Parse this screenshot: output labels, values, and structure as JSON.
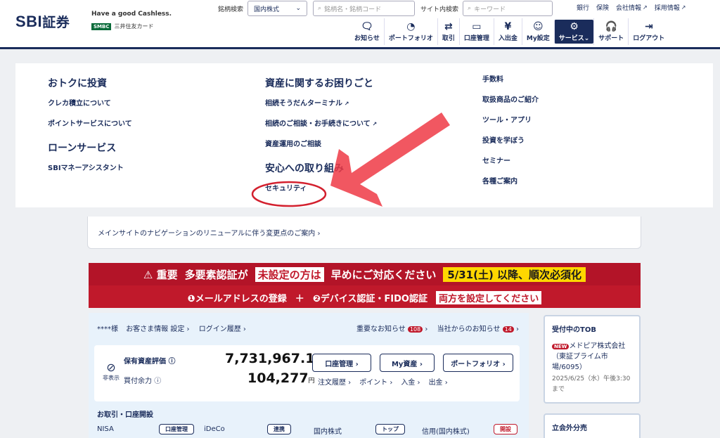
{
  "brand": {
    "logo_main": "SBI",
    "logo_sub": "証券",
    "tagline": "Have a good Cashless.",
    "smbc_badge": "SMBC",
    "smbc_text": "三井住友カード"
  },
  "search": {
    "stock_label": "銘柄検索",
    "market_select": "国内株式",
    "stock_placeholder": "銘柄名・銘柄コード",
    "site_label": "サイト内検索",
    "site_placeholder": "キーワード"
  },
  "top_links": [
    "銀行",
    "保険",
    "会社情報",
    "採用情報"
  ],
  "nav": [
    {
      "label": "お知らせ",
      "icon": "message-icon",
      "glyph": "🗨"
    },
    {
      "label": "ポートフォリオ",
      "icon": "pie-chart-icon",
      "glyph": "◔"
    },
    {
      "label": "取引",
      "icon": "exchange-icon",
      "glyph": "⇄"
    },
    {
      "label": "口座管理",
      "icon": "account-icon",
      "glyph": "▭"
    },
    {
      "label": "入出金",
      "icon": "yen-icon",
      "glyph": "¥"
    },
    {
      "label": "My設定",
      "icon": "user-icon",
      "glyph": "☺"
    },
    {
      "label": "サービス",
      "icon": "service-icon",
      "glyph": "⚙"
    },
    {
      "label": "サポート",
      "icon": "headset-icon",
      "glyph": "🎧"
    },
    {
      "label": "ログアウト",
      "icon": "logout-icon",
      "glyph": "⇥"
    }
  ],
  "mega_menu": {
    "col1": {
      "heading1": "おトクに投資",
      "links1": [
        "クレカ積立について",
        "ポイントサービスについて"
      ],
      "heading2": "ローンサービス",
      "links2": [
        "SBIマネーアシスタント"
      ]
    },
    "col2": {
      "heading1": "資産に関するお困りごと",
      "links1": [
        "相続そうだんターミナル",
        "相続のご相談・お手続きについて",
        "資産運用のご相談"
      ],
      "heading2": "安心への取り組み",
      "links2": [
        "セキュリティ"
      ]
    },
    "col3": {
      "links": [
        "手数料",
        "取扱商品のご紹介",
        "ツール・アプリ",
        "投資を学ぼう",
        "セミナー",
        "各種ご案内"
      ]
    }
  },
  "notice": {
    "text": "メインサイトのナビゲーションのリニューアルに伴う変更点のご案内 ›"
  },
  "banner": {
    "important": "⚠ 重要",
    "line1_a": "多要素認証が",
    "line1_b": "未設定の方は",
    "line1_c": "早めにご対応ください",
    "line1_d": "5/31(土) 以降、順次必須化",
    "line2_a": "❶メールアドレスの登録",
    "plus": "＋",
    "line2_b": "❷デバイス認証・FIDO認証",
    "line2_c": "両方を設定してください"
  },
  "account": {
    "user": "****様",
    "customer_info": "お客さま情報 設定 ›",
    "login_history": "ログイン履歴 ›",
    "important_notice": "重要なお知らせ",
    "important_count": "108",
    "company_notice": "当社からのお知らせ",
    "company_count": "14",
    "hide_label": "非表示",
    "holdings_label": "保有資産評価",
    "holdings_value": "7,731,967.1",
    "buying_power_label": "買付余力",
    "buying_power_value": "104,277",
    "yen": "円",
    "btn_account": "口座管理 ›",
    "btn_myasset": "My資産 ›",
    "btn_portfolio": "ポートフォリオ ›",
    "sublinks": [
      "注文履歴 ›",
      "ポイント ›",
      "入金 ›",
      "出金 ›"
    ],
    "trade_title": "お取引・口座開設",
    "nisa": "NISA",
    "nisa_btn": "口座管理",
    "ideco": "iDeCo",
    "ideco_btn": "連携",
    "domestic": "国内株式",
    "domestic_btn": "トップ",
    "margin": "信用(国内株式)",
    "margin_btn": "開設"
  },
  "tob": {
    "title": "受付中のTOB",
    "new": "NEW",
    "company": "メドピア株式会社（東証プライム市場/6095）",
    "date": "2025/6/25（水）午後3:30まで"
  },
  "side2": {
    "title": "立会外分売"
  }
}
